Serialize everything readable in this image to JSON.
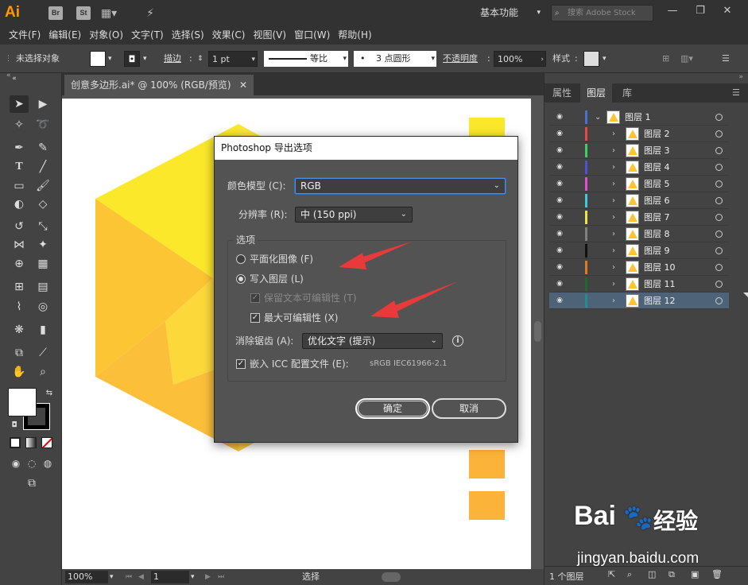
{
  "app": {
    "logo_text": "Ai",
    "bridge_badge": "Br",
    "stock_badge": "St",
    "workspace_label": "基本功能",
    "stock_search_placeholder": "搜索 Adobe Stock"
  },
  "menubar": {
    "items": [
      "文件(F)",
      "编辑(E)",
      "对象(O)",
      "文字(T)",
      "选择(S)",
      "效果(C)",
      "视图(V)",
      "窗口(W)",
      "帮助(H)"
    ]
  },
  "controlbar": {
    "selection_status": "未选择对象",
    "stroke_label": "描边",
    "stroke_weight": "1 pt",
    "stroke_profile": "等比",
    "brush_value": "3 点圆形",
    "opacity_label": "不透明度",
    "opacity_value": "100%",
    "style_label": "样式"
  },
  "document": {
    "tab_title": "创意多边形.ai* @ 100% (RGB/预览)"
  },
  "statusbar": {
    "zoom": "100%",
    "artboard_number": "1",
    "tool_status": "选择"
  },
  "layers_panel": {
    "tabs": [
      "属性",
      "图层",
      "库"
    ],
    "active_tab": "图层",
    "layers": [
      {
        "name": "图层 1",
        "color": "#4a6fd8",
        "level": 0,
        "expanded": true
      },
      {
        "name": "图层 2",
        "color": "#e84848",
        "level": 1
      },
      {
        "name": "图层 3",
        "color": "#3ccf62",
        "level": 1
      },
      {
        "name": "图层 4",
        "color": "#4e52d6",
        "level": 1
      },
      {
        "name": "图层 5",
        "color": "#e54fcf",
        "level": 1
      },
      {
        "name": "图层 6",
        "color": "#3fc9dc",
        "level": 1
      },
      {
        "name": "图层 7",
        "color": "#f0e640",
        "level": 1
      },
      {
        "name": "图层 8",
        "color": "#808080",
        "level": 1
      },
      {
        "name": "图层 9",
        "color": "#111111",
        "level": 1
      },
      {
        "name": "图层 10",
        "color": "#e07a1e",
        "level": 1
      },
      {
        "name": "图层 11",
        "color": "#1f6a2a",
        "level": 1
      },
      {
        "name": "图层 12",
        "color": "#1e8f8f",
        "level": 1,
        "selected": true
      }
    ],
    "footer_count": "1 个图层"
  },
  "dialog": {
    "title": "Photoshop 导出选项",
    "color_model_label": "颜色模型 (C):",
    "color_model_value": "RGB",
    "resolution_label": "分辨率 (R):",
    "resolution_value": "中 (150 ppi)",
    "options_group_label": "选项",
    "flat_image_label": "平面化图像 (F)",
    "write_layers_label": "写入图层 (L)",
    "preserve_text_label": "保留文本可编辑性 (T)",
    "max_editable_label": "最大可编辑性 (X)",
    "antialias_label": "消除锯齿 (A):",
    "antialias_value": "优化文字 (提示)",
    "embed_icc_label": "嵌入 ICC 配置文件 (E):",
    "icc_profile": "sRGB IEC61966-2.1",
    "ok_label": "确定",
    "cancel_label": "取消",
    "write_layers_selected": true,
    "max_editable_checked": true,
    "embed_icc_checked": true,
    "preserve_text_checked": true
  },
  "watermark": {
    "brand": "Bai",
    "brand_suffix": "经验",
    "url": "jingyan.baidu.com"
  },
  "colors": {
    "accent_selection": "#4e6378",
    "hexagon_yellow": "#fce82a",
    "hexagon_orange": "#fbb33a",
    "annotation_red": "#e83a3a"
  }
}
